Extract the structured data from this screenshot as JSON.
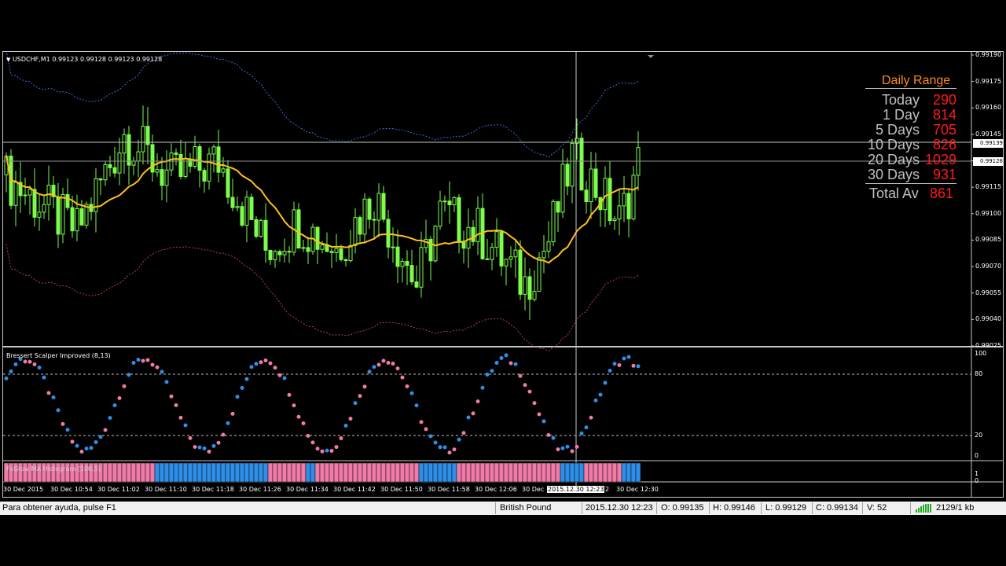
{
  "chart": {
    "title": "USDCHF,M1  0.99123 0.99128 0.99123 0.99128",
    "price_ticks": [
      "0.99190",
      "0.99175",
      "0.99160",
      "0.99145",
      "0.99130",
      "0.99115",
      "0.99100",
      "0.99085",
      "0.99070",
      "0.99055",
      "0.99040",
      "0.99025"
    ],
    "price_min": 0.99025,
    "price_max": 0.9919,
    "line_label_top": "0.99139",
    "line_label_bottom": "0.99128",
    "candle_color": "#7cfc4c",
    "ma_color": "#ffc01e",
    "upper_band_color": "#3a6fd8",
    "lower_band_color": "#b04060"
  },
  "daily_range": {
    "title": "Daily Range",
    "rows": [
      {
        "name": "Today",
        "value": "290"
      },
      {
        "name": "1 Day",
        "value": "814"
      },
      {
        "name": "5 Days",
        "value": "705"
      },
      {
        "name": "10 Days",
        "value": "826"
      },
      {
        "name": "20 Days",
        "value": "1029"
      },
      {
        "name": "30 Days",
        "value": "931"
      }
    ],
    "total_label": "Total Av",
    "total_value": "861"
  },
  "indicator": {
    "title": "Bressert Scalper Improved (8,13)",
    "levels": [
      "100",
      "80",
      "20",
      "0"
    ],
    "up_color": "#2f8fe8",
    "down_color": "#f07aa8"
  },
  "histogram": {
    "title": "FxGlow MA Histogram (100,5)",
    "levels": [
      "1",
      "0"
    ],
    "pink_color": "#f07aa8",
    "blue_color": "#2f8fe8"
  },
  "time_axis": {
    "labels": [
      "30 Dec 2015",
      "30 Dec 10:54",
      "30 Dec 11:02",
      "30 Dec 11:10",
      "30 Dec 11:18",
      "30 Dec 11:26",
      "30 Dec 11:34",
      "30 Dec 11:42",
      "30 Dec 11:50",
      "30 Dec 11:58",
      "30 Dec 12:06",
      "30 Dec",
      "2015.12.30 12:23",
      "2",
      "30 Dec 12:30"
    ]
  },
  "status_bar": {
    "help": "Para obtener ayuda, pulse F1",
    "profile": "British Pound",
    "datetime": "2015.12.30 12:23",
    "open": "O: 0.99135",
    "high": "H: 0.99146",
    "low": "L: 0.99129",
    "close": "C: 0.99134",
    "volume": "V: 52",
    "traffic": "2129/1 kb"
  }
}
